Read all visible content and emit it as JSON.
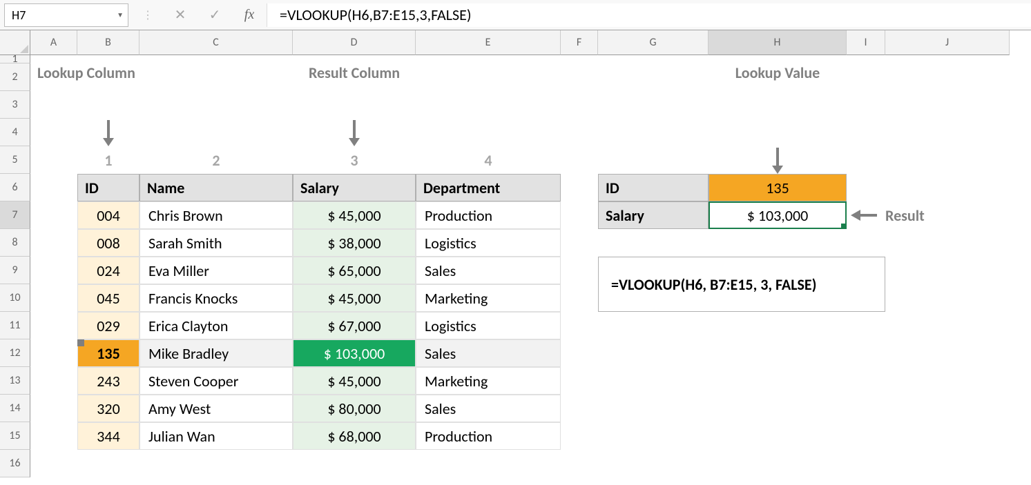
{
  "formula_bar": {
    "name_box": "H7",
    "formula": "=VLOOKUP(H6,B7:E15,3,FALSE)"
  },
  "columns": [
    "A",
    "B",
    "C",
    "D",
    "E",
    "F",
    "G",
    "H",
    "I",
    "J"
  ],
  "rows": [
    "1",
    "2",
    "3",
    "4",
    "5",
    "6",
    "7",
    "8",
    "9",
    "10",
    "11",
    "12",
    "13",
    "14",
    "15",
    "16"
  ],
  "annotations": {
    "lookup_column": "Lookup Column",
    "result_column": "Result Column",
    "lookup_value": "Lookup Value",
    "result": "Result"
  },
  "col_numbers": {
    "c1": "1",
    "c2": "2",
    "c3": "3",
    "c4": "4"
  },
  "table": {
    "headers": {
      "id": "ID",
      "name": "Name",
      "salary": "Salary",
      "dept": "Department"
    },
    "rows": [
      {
        "id": "004",
        "name": "Chris Brown",
        "salary": "$  45,000",
        "dept": "Production"
      },
      {
        "id": "008",
        "name": "Sarah Smith",
        "salary": "$  38,000",
        "dept": "Logistics"
      },
      {
        "id": "024",
        "name": "Eva Miller",
        "salary": "$  65,000",
        "dept": "Sales"
      },
      {
        "id": "045",
        "name": "Francis Knocks",
        "salary": "$  45,000",
        "dept": "Marketing"
      },
      {
        "id": "029",
        "name": "Erica Clayton",
        "salary": "$  67,000",
        "dept": "Logistics"
      },
      {
        "id": "135",
        "name": "Mike Bradley",
        "salary": "$ 103,000",
        "dept": "Sales"
      },
      {
        "id": "243",
        "name": "Steven Cooper",
        "salary": "$  45,000",
        "dept": "Marketing"
      },
      {
        "id": "320",
        "name": "Amy West",
        "salary": "$  80,000",
        "dept": "Sales"
      },
      {
        "id": "344",
        "name": "Julian Wan",
        "salary": "$  68,000",
        "dept": "Production"
      }
    ]
  },
  "lookup": {
    "id_label": "ID",
    "id_value": "135",
    "salary_label": "Salary",
    "salary_value": "$    103,000"
  },
  "formula_display": "=VLOOKUP(H6, B7:E15, 3, FALSE)"
}
